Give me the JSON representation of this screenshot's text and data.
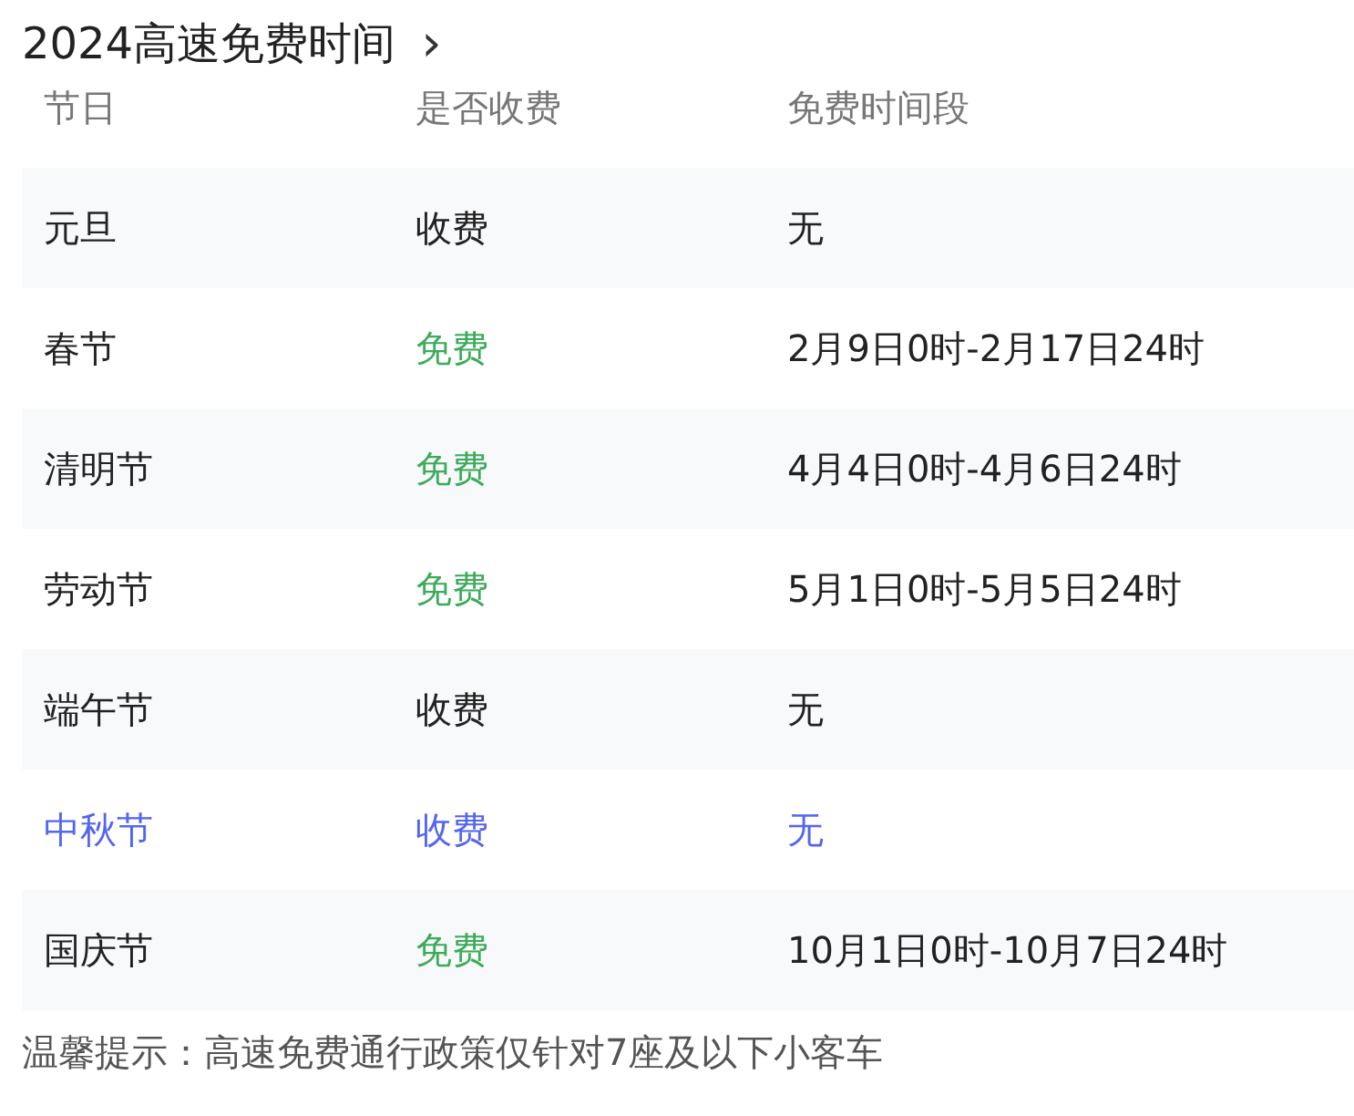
{
  "title": "2024高速免费时间",
  "title_arrow": "›",
  "table": {
    "columns": [
      "节日",
      "是否收费",
      "免费时间段"
    ],
    "rows": [
      {
        "holiday": "元旦",
        "fee": "收费",
        "free": false,
        "period": "无",
        "selected": false
      },
      {
        "holiday": "春节",
        "fee": "免费",
        "free": true,
        "period": "2月9日0时-2月17日24时",
        "selected": false
      },
      {
        "holiday": "清明节",
        "fee": "免费",
        "free": true,
        "period": "4月4日0时-4月6日24时",
        "selected": false
      },
      {
        "holiday": "劳动节",
        "fee": "免费",
        "free": true,
        "period": "5月1日0时-5月5日24时",
        "selected": false
      },
      {
        "holiday": "端午节",
        "fee": "收费",
        "free": false,
        "period": "无",
        "selected": false
      },
      {
        "holiday": "中秋节",
        "fee": "收费",
        "free": false,
        "period": "无",
        "selected": true
      },
      {
        "holiday": "国庆节",
        "fee": "免费",
        "free": true,
        "period": "10月1日0时-10月7日24时",
        "selected": false
      }
    ]
  },
  "note": "温馨提示：高速免费通行政策仅针对7座及以下小客车"
}
